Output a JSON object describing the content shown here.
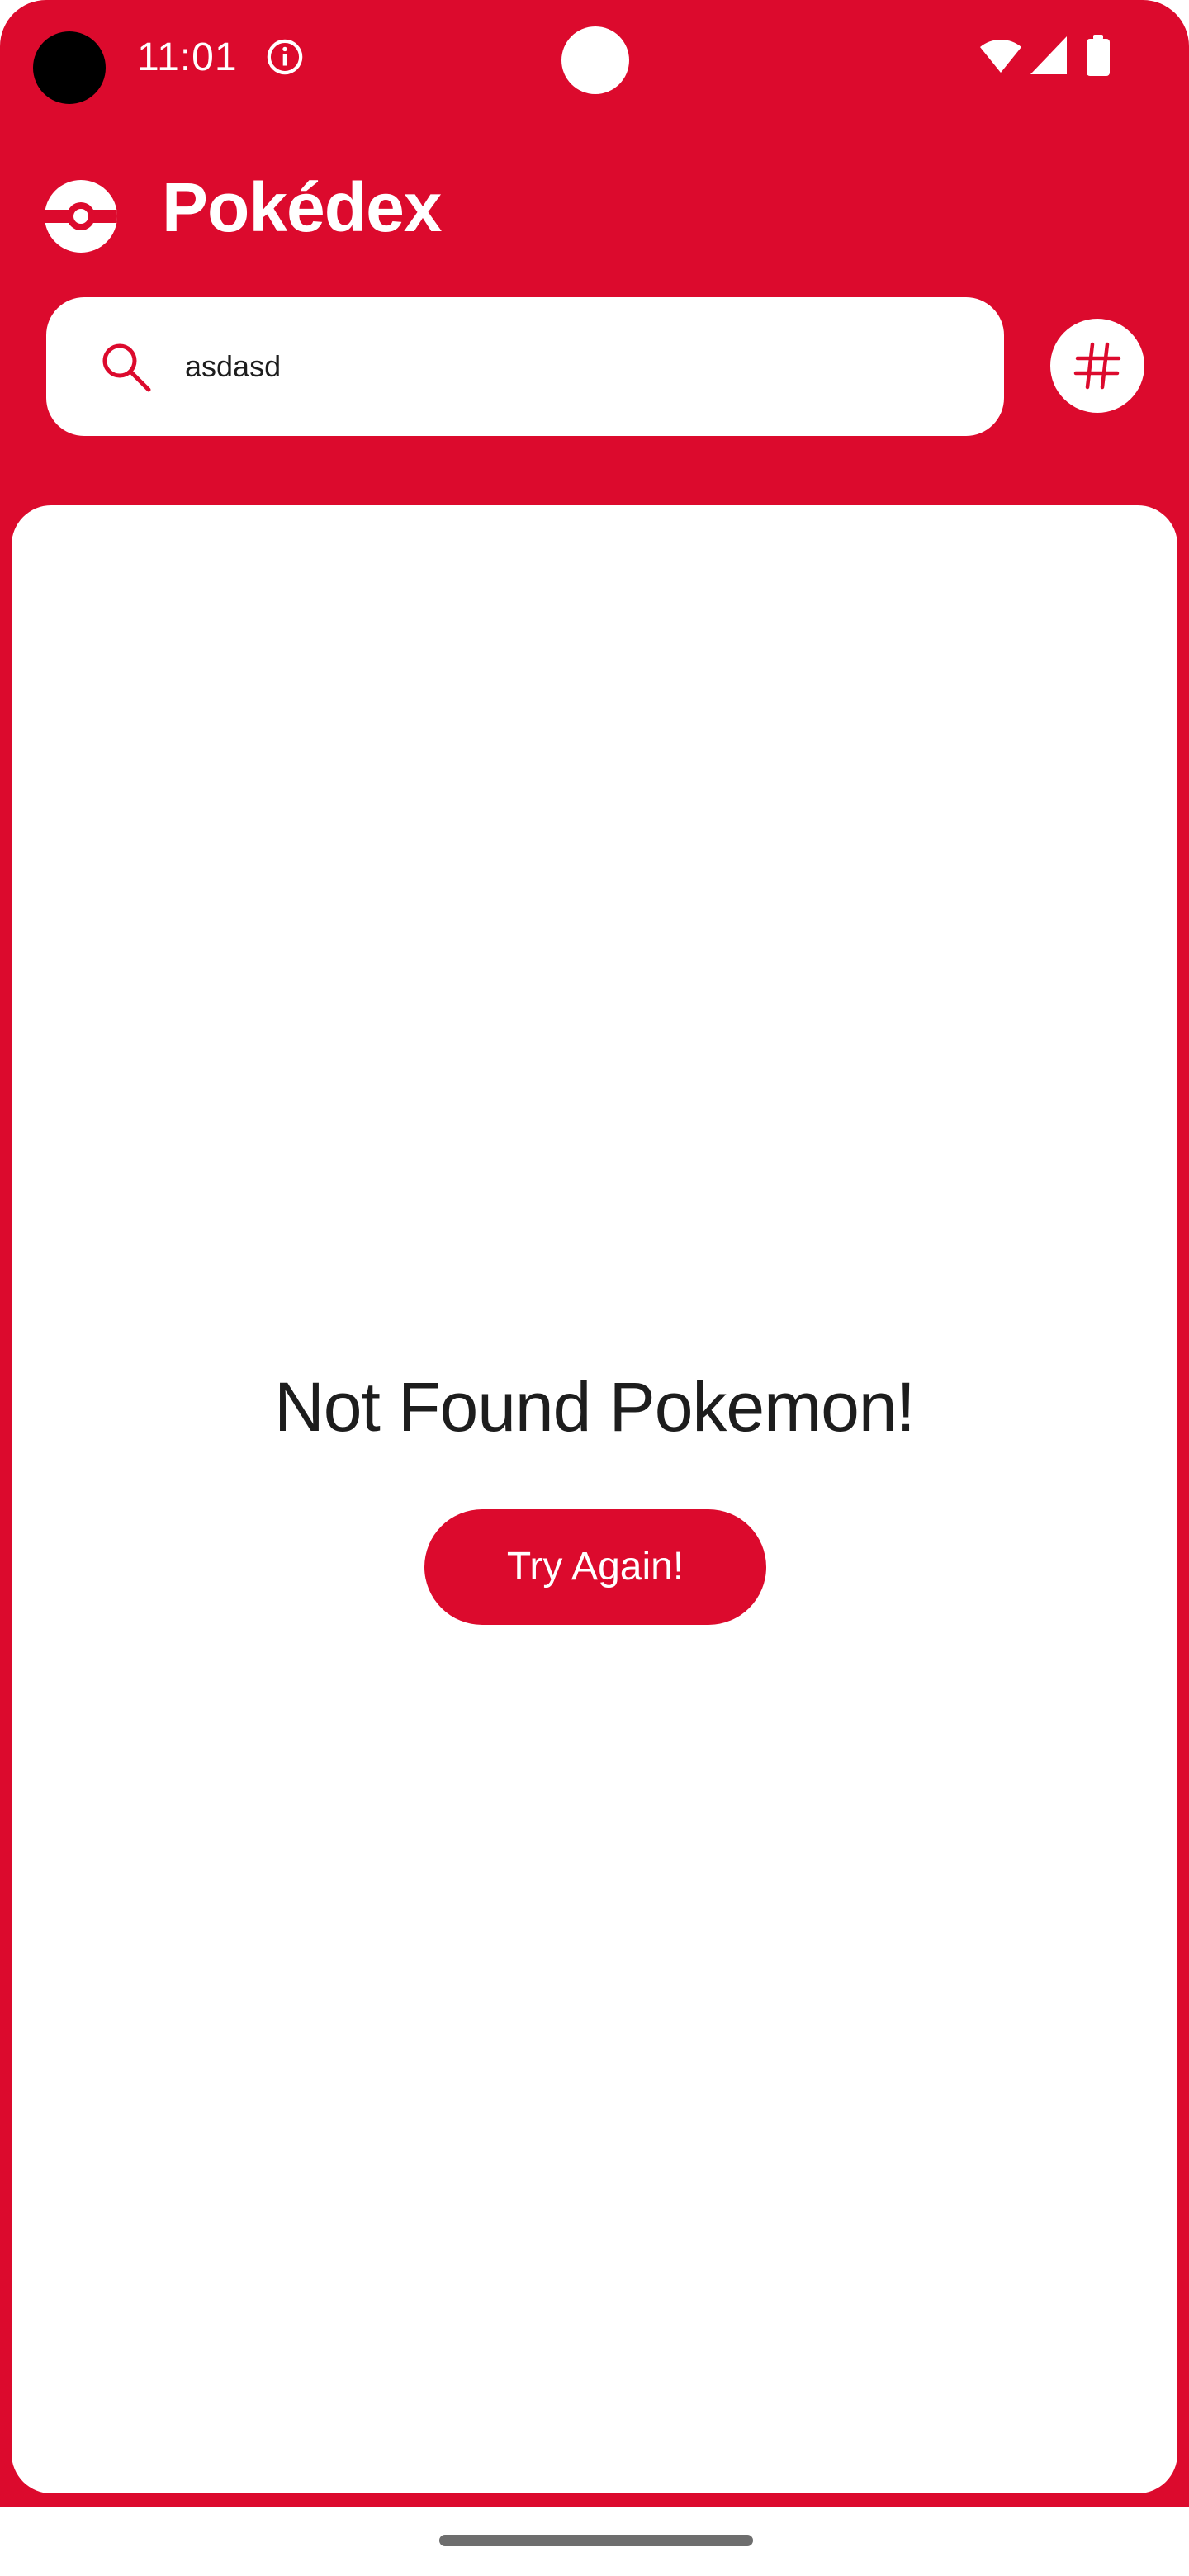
{
  "status_bar": {
    "time": "11:01",
    "icons": [
      "info-icon",
      "wifi-icon",
      "signal-icon",
      "battery-icon"
    ]
  },
  "header": {
    "title": "Pokédex",
    "logo_icon": "pokeball-icon"
  },
  "search": {
    "value": "asdasd",
    "icon": "search-icon"
  },
  "sort_button": {
    "icon": "hash-icon"
  },
  "empty_state": {
    "message": "Not Found Pokemon!",
    "retry_label": "Try Again!"
  },
  "colors": {
    "primary": "#DC0A2D",
    "surface": "#FFFFFF",
    "text_dark": "#1D1D1D",
    "gesture_bar": "#6E6E6E"
  }
}
